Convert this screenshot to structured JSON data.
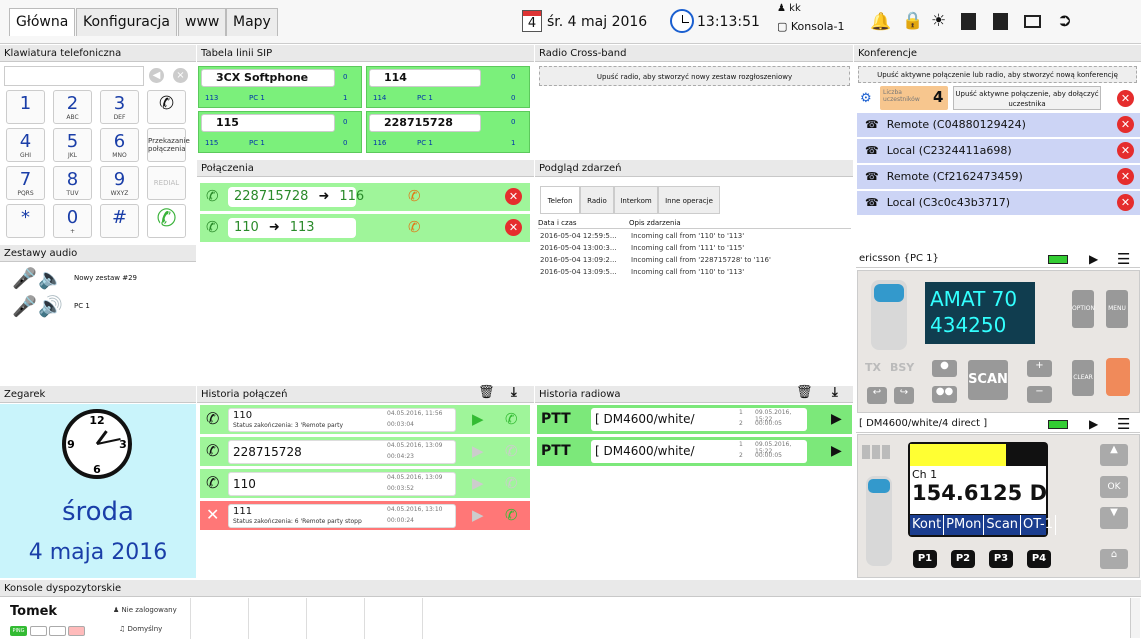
{
  "tabs": [
    "Główna",
    "Konfiguracja",
    "www",
    "Mapy"
  ],
  "topbar": {
    "date_icon_num": "4",
    "date": "śr. 4 maj 2016",
    "time": "13:13:51",
    "user": "kk",
    "console": "Konsola-1"
  },
  "panels": {
    "keypad": "Klawiatura telefoniczna",
    "sip": "Tabela linii SIP",
    "radio_cross": "Radio Cross-band",
    "conferences": "Konferencje",
    "connections": "Połączenia",
    "events": "Podgląd zdarzeń",
    "audio": "Zestawy audio",
    "clock": "Zegarek",
    "call_history": "Historia połączeń",
    "radio_history": "Historia radiowa",
    "consoles": "Konsole dyspozytorskie"
  },
  "keypad": {
    "keys": [
      {
        "d": "1",
        "s": ""
      },
      {
        "d": "2",
        "s": "ABC"
      },
      {
        "d": "3",
        "s": "DEF"
      },
      {
        "d": "4",
        "s": "GHI"
      },
      {
        "d": "5",
        "s": "JKL"
      },
      {
        "d": "6",
        "s": "MNO"
      },
      {
        "d": "7",
        "s": "PQRS"
      },
      {
        "d": "8",
        "s": "TUV"
      },
      {
        "d": "9",
        "s": "WXYZ"
      },
      {
        "d": "*",
        "s": ""
      },
      {
        "d": "0",
        "s": "+"
      },
      {
        "d": "#",
        "s": ""
      }
    ],
    "transfer": "Przekazanie połączenia",
    "redial": "REDIAL"
  },
  "sip": {
    "lines": [
      {
        "name": "3CX Softphone",
        "num": "113",
        "pc": "PC 1",
        "c1": "0",
        "c2": "1"
      },
      {
        "name": "114",
        "num": "114",
        "pc": "PC 1",
        "c1": "0",
        "c2": "0"
      },
      {
        "name": "115",
        "num": "115",
        "pc": "PC 1",
        "c1": "0",
        "c2": "0"
      },
      {
        "name": "228715728",
        "num": "116",
        "pc": "PC 1",
        "c1": "0",
        "c2": "1"
      }
    ]
  },
  "radio_cross": {
    "drop": "Upuść radio, aby stworzyć nowy zestaw rozgłoszeniowy"
  },
  "connections": [
    {
      "from": "228715728",
      "to": "116"
    },
    {
      "from": "110",
      "to": "113"
    }
  ],
  "events": {
    "tabs": [
      "Telefon",
      "Radio",
      "Interkom",
      "Inne operacje"
    ],
    "col_date": "Data i czas",
    "col_desc": "Opis zdarzenia",
    "rows": [
      {
        "d": "2016-05-04 12:59:5...",
        "t": "Incoming call from '110' to '113'"
      },
      {
        "d": "2016-05-04 13:00:3...",
        "t": "Incoming call from '111' to '115'"
      },
      {
        "d": "2016-05-04 13:09:2...",
        "t": "Incoming call from '228715728' to '116'"
      },
      {
        "d": "2016-05-04 13:09:5...",
        "t": "Incoming call from '110' to '113'"
      }
    ]
  },
  "conferences": {
    "drop": "Upuść aktywne połączenie lub radio, aby stworzyć nową konferencję",
    "count_label": "Liczba uczestników",
    "count": "4",
    "drop_add": "Upuść aktywne połączenie, aby dołączyć uczestnika",
    "members": [
      "Remote  (C04880129424)",
      "Local  (C2324411a698)",
      "Remote  (Cf2162473459)",
      "Local  (C3c0c43b3717)"
    ]
  },
  "audio": {
    "sets": [
      "Nowy zestaw #29",
      "PC 1"
    ]
  },
  "clock": {
    "day": "środa",
    "date": "4 maja 2016",
    "hour": 13,
    "minute": 13
  },
  "call_history": [
    {
      "num": "110",
      "status": "Status zakończenia: 3 'Remote party",
      "date": "04.05.2016, 11:56",
      "dur": "00:03:04"
    },
    {
      "num": "228715728",
      "status": "",
      "date": "04.05.2016, 13:09",
      "dur": "00:04:23"
    },
    {
      "num": "110",
      "status": "",
      "date": "04.05.2016, 13:09",
      "dur": "00:03:52"
    },
    {
      "num": "111",
      "status": "Status zakończenia: 6 'Remote party stopp",
      "date": "04.05.2016, 13:10",
      "dur": "00:00:24"
    }
  ],
  "radio_history": [
    {
      "ptt": "PTT",
      "name": "[ DM4600/white/",
      "a": "1",
      "b": "2",
      "date": "09.05.2016, 15:22",
      "dur": "00:00:05"
    },
    {
      "ptt": "PTT",
      "name": "[ DM4600/white/",
      "a": "1",
      "b": "2",
      "date": "09.05.2016, 15:22",
      "dur": "00:00:05"
    }
  ],
  "radio1": {
    "title": "ericsson {PC 1}",
    "line1": "AMAT 70",
    "line2": "434250",
    "tx": "TX",
    "bsy": "BSY",
    "scan": "SCAN",
    "opt": "OPTION",
    "menu": "MENU",
    "clear": "CLEAR"
  },
  "radio2": {
    "title": "[ DM4600/white/4 direct ]",
    "ch": "Ch 1",
    "freq": "154.6125 D",
    "soft": [
      "Kont",
      "PMon",
      "Scan",
      "OT-1"
    ],
    "p": [
      "P1",
      "P2",
      "P3",
      "P4"
    ],
    "ok": "OK"
  },
  "consoles": {
    "name": "Tomek",
    "status": "Nie zalogowany",
    "default": "Domyślny",
    "ping": "PING"
  }
}
